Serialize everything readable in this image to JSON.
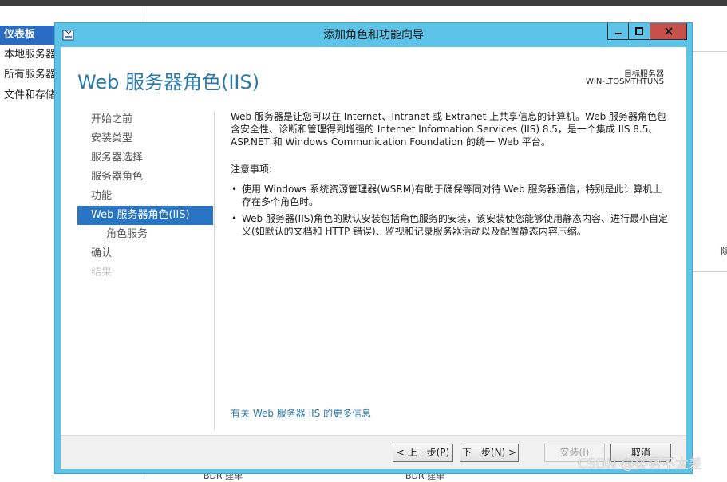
{
  "background": {
    "sidebar": [
      "仪表板",
      "本地服务器",
      "所有服务器",
      "文件和存储服务"
    ],
    "right_text": "隐",
    "bottom_left": "BDR 建单",
    "bottom_right": "BDR 建单"
  },
  "dialog": {
    "title": "添加角色和功能向导",
    "page_title": "Web 服务器角色(IIS)",
    "target_label": "目标服务器",
    "target_name": "WIN-LTOSMTHTUNS",
    "nav": [
      {
        "label": "开始之前",
        "state": "normal"
      },
      {
        "label": "安装类型",
        "state": "normal"
      },
      {
        "label": "服务器选择",
        "state": "normal"
      },
      {
        "label": "服务器角色",
        "state": "normal"
      },
      {
        "label": "功能",
        "state": "normal"
      },
      {
        "label": "Web 服务器角色(IIS)",
        "state": "active"
      },
      {
        "label": "角色服务",
        "state": "sub"
      },
      {
        "label": "确认",
        "state": "normal"
      },
      {
        "label": "结果",
        "state": "disabled"
      }
    ],
    "intro": "Web 服务器是让您可以在 Internet、Intranet 或 Extranet 上共享信息的计算机。Web 服务器角色包含安全性、诊断和管理得到增强的 Internet Information Services (IIS) 8.5，是一个集成 IIS 8.5、ASP.NET 和 Windows Communication Foundation 的统一 Web 平台。",
    "notes_label": "注意事项:",
    "bullets": [
      "使用 Windows 系统资源管理器(WSRM)有助于确保等同对待 Web 服务器通信，特别是此计算机上存在多个角色时。",
      "Web 服务器(IIS)角色的默认安装包括角色服务的安装，该安装使您能够使用静态内容、进行最小自定义(如默认的文档和 HTTP 错误)、监视和记录服务器活动以及配置静态内容压缩。"
    ],
    "more_link": "有关 Web 服务器 IIS 的更多信息",
    "buttons": {
      "prev": "< 上一步(P)",
      "next": "下一步(N) >",
      "install": "安装(I)",
      "cancel": "取消"
    }
  },
  "watermark": "CSDN @姿势不太差"
}
